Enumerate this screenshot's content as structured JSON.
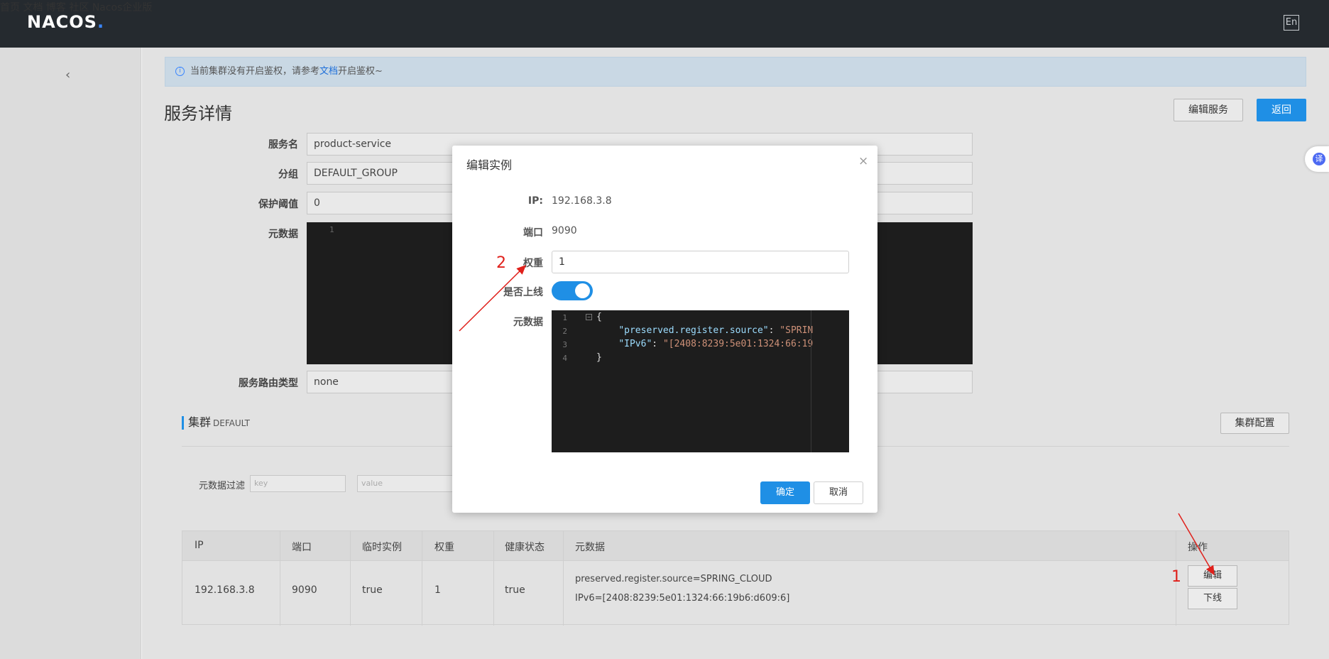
{
  "header": {
    "logo_text": "NACOS",
    "logo_suffix": ".",
    "nav": [
      "首页",
      "文档",
      "博客",
      "社区",
      "Nacos企业版"
    ],
    "lang": "En"
  },
  "notice": {
    "before": "当前集群没有开启鉴权，请参考",
    "link": "文档",
    "after": "开启鉴权~"
  },
  "page": {
    "title": "服务详情",
    "edit_service_label": "编辑服务",
    "back_label": "返回"
  },
  "service_form": {
    "name_label": "服务名",
    "name_value": "product-service",
    "group_label": "分组",
    "group_value": "DEFAULT_GROUP",
    "threshold_label": "保护阈值",
    "threshold_value": "0",
    "metadata_label": "元数据",
    "editor_line": "1",
    "route_label": "服务路由类型",
    "route_value": "none"
  },
  "cluster": {
    "title": "集群",
    "name": "DEFAULT",
    "config_label": "集群配置",
    "filter_label": "元数据过滤",
    "key_placeholder": "key",
    "value_placeholder": "value"
  },
  "table": {
    "headers": [
      "IP",
      "端口",
      "临时实例",
      "权重",
      "健康状态",
      "元数据",
      "操作"
    ],
    "row": {
      "ip": "192.168.3.8",
      "port": "9090",
      "ephemeral": "true",
      "weight": "1",
      "healthy": "true",
      "meta1": "preserved.register.source=SPRING_CLOUD",
      "meta2": "IPv6=[2408:8239:5e01:1324:66:19b6:d609:6]",
      "edit_label": "编辑",
      "offline_label": "下线"
    }
  },
  "side_badge": "译",
  "modal": {
    "title": "编辑实例",
    "close": "×",
    "ip_label": "IP:",
    "ip_value": "192.168.3.8",
    "port_label": "端口",
    "port_value": "9090",
    "weight_label": "权重",
    "weight_value": "1",
    "online_label": "是否上线",
    "online": true,
    "metadata_label": "元数据",
    "code_lines": [
      {
        "n": "1",
        "text": "{"
      },
      {
        "n": "2",
        "key": "\"preserved.register.source\"",
        "sep": ": ",
        "val": "\"SPRIN"
      },
      {
        "n": "3",
        "key": "\"IPv6\"",
        "sep": ": ",
        "val": "\"[2408:8239:5e01:1324:66:19"
      },
      {
        "n": "4",
        "text": "}"
      }
    ],
    "confirm_label": "确定",
    "cancel_label": "取消"
  },
  "annotations": {
    "one": "1",
    "two": "2",
    "color": "#e0201b"
  }
}
